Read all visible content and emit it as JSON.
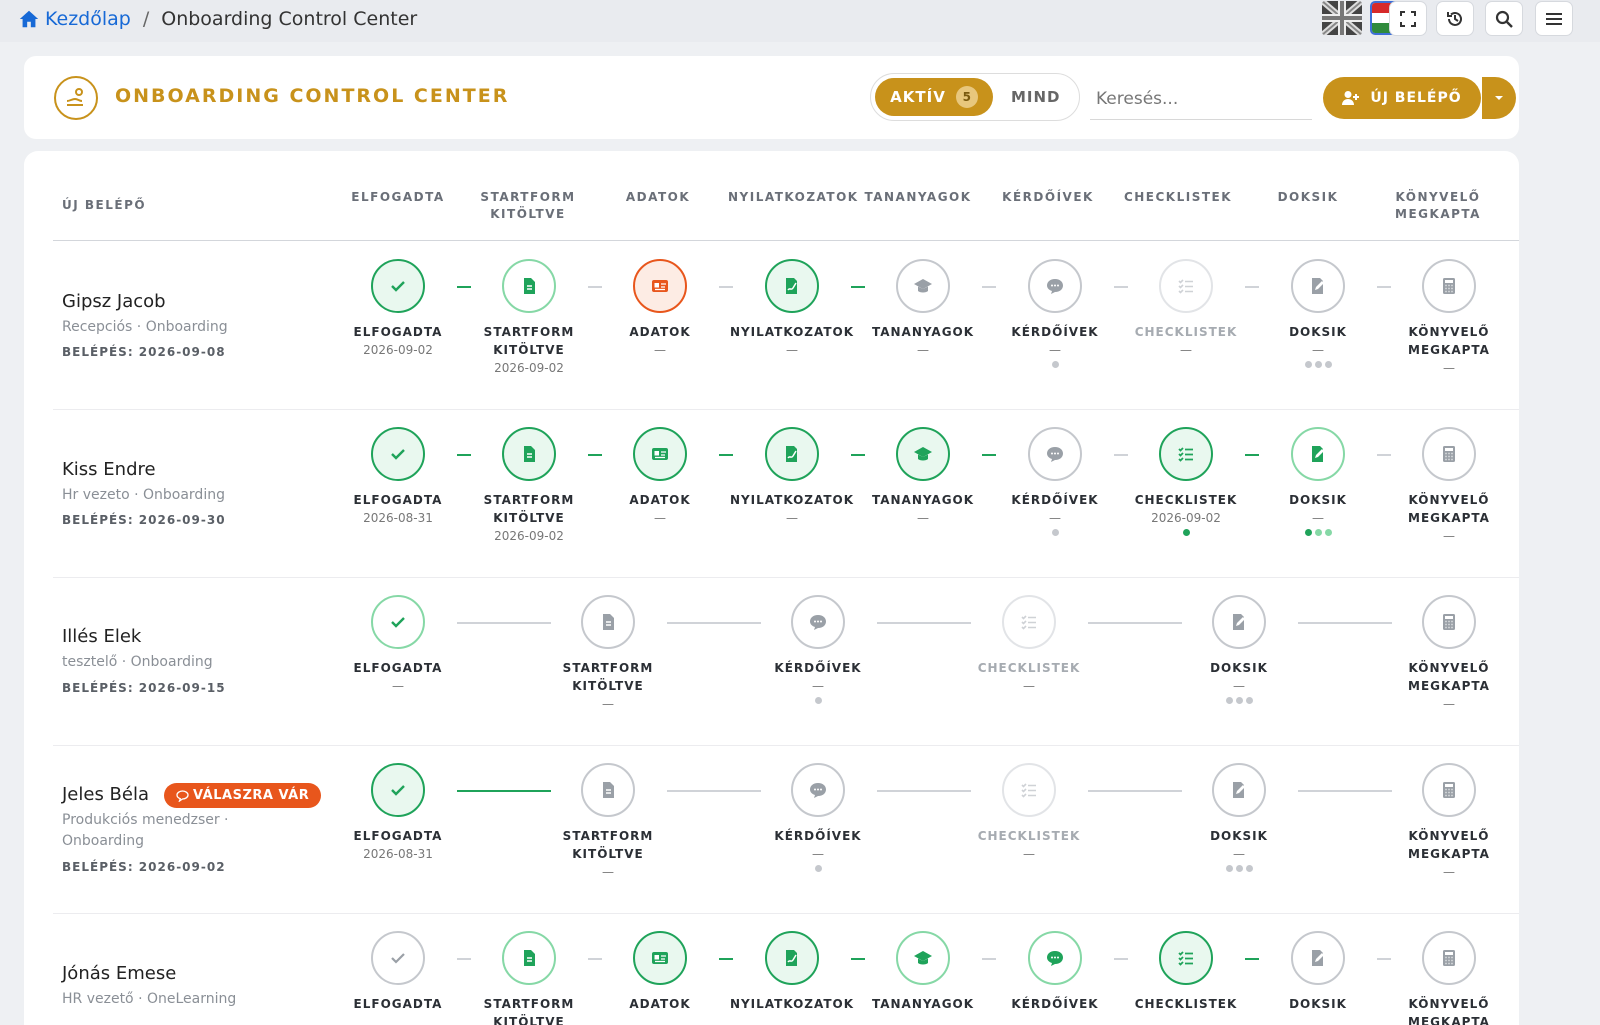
{
  "breadcrumb": {
    "home": "Kezdőlap",
    "separator": "/",
    "current": "Onboarding Control Center"
  },
  "header": {
    "title": "ONBOARDING CONTROL CENTER",
    "filter_active": "AKTÍV",
    "active_count": "5",
    "filter_all": "MIND",
    "search_placeholder": "Keresés...",
    "new_button": "ÚJ BELÉPŐ"
  },
  "columns": {
    "entrant": "ÚJ BELÉPŐ",
    "accepted": "ELFOGADTA",
    "startform_1": "STARTFORM",
    "startform_2": "KITÖLTVE",
    "data": "ADATOK",
    "statements": "NYILATKOZATOK",
    "materials": "TANANYAGOK",
    "surveys": "KÉRDŐÍVEK",
    "checklists": "CHECKLISTEK",
    "docs": "DOKSIK",
    "accountant_1": "KÖNYVELŐ",
    "accountant_2": "MEGKAPTA"
  },
  "colors": {
    "accent": "#c8921b",
    "green": "#1fa35a",
    "orange": "#e8561c",
    "grey": "#c5c8cd"
  },
  "rows": [
    {
      "name": "Gipsz Jacob",
      "role": "Recepciós · Onboarding",
      "entry": "BELÉPÉS: 2026-09-08",
      "steps": {
        "accepted_date": "2026-09-02",
        "startform_date": "2026-09-02",
        "data_sub": "—",
        "statements_sub": "—",
        "materials_sub": "—",
        "surveys_sub": "—",
        "checklists_sub": "—",
        "docs_sub": "—",
        "accountant_sub": "—"
      }
    },
    {
      "name": "Kiss Endre",
      "role": "Hr vezeto · Onboarding",
      "entry": "BELÉPÉS: 2026-09-30",
      "steps": {
        "accepted_date": "2026-08-31",
        "startform_date": "2026-09-02",
        "data_sub": "—",
        "statements_sub": "—",
        "materials_sub": "—",
        "surveys_sub": "—",
        "checklists_date": "2026-09-02",
        "docs_sub": "—",
        "accountant_sub": "—"
      }
    },
    {
      "name": "Illés Elek",
      "role": "tesztelő · Onboarding",
      "entry": "BELÉPÉS: 2026-09-15",
      "steps": {
        "accepted_sub": "—",
        "startform_sub": "—",
        "surveys_sub": "—",
        "checklists_sub": "—",
        "docs_sub": "—",
        "accountant_sub": "—"
      }
    },
    {
      "name": "Jeles Béla",
      "badge": "VÁLASZRA VÁR",
      "role": "Produkciós menedzser · Onboarding",
      "entry": "BELÉPÉS: 2026-09-02",
      "steps": {
        "accepted_date": "2026-08-31",
        "startform_sub": "—",
        "surveys_sub": "—",
        "checklists_sub": "—",
        "docs_sub": "—",
        "accountant_sub": "—"
      }
    },
    {
      "name": "Jónás Emese",
      "role": "HR vezető · OneLearning"
    }
  ]
}
